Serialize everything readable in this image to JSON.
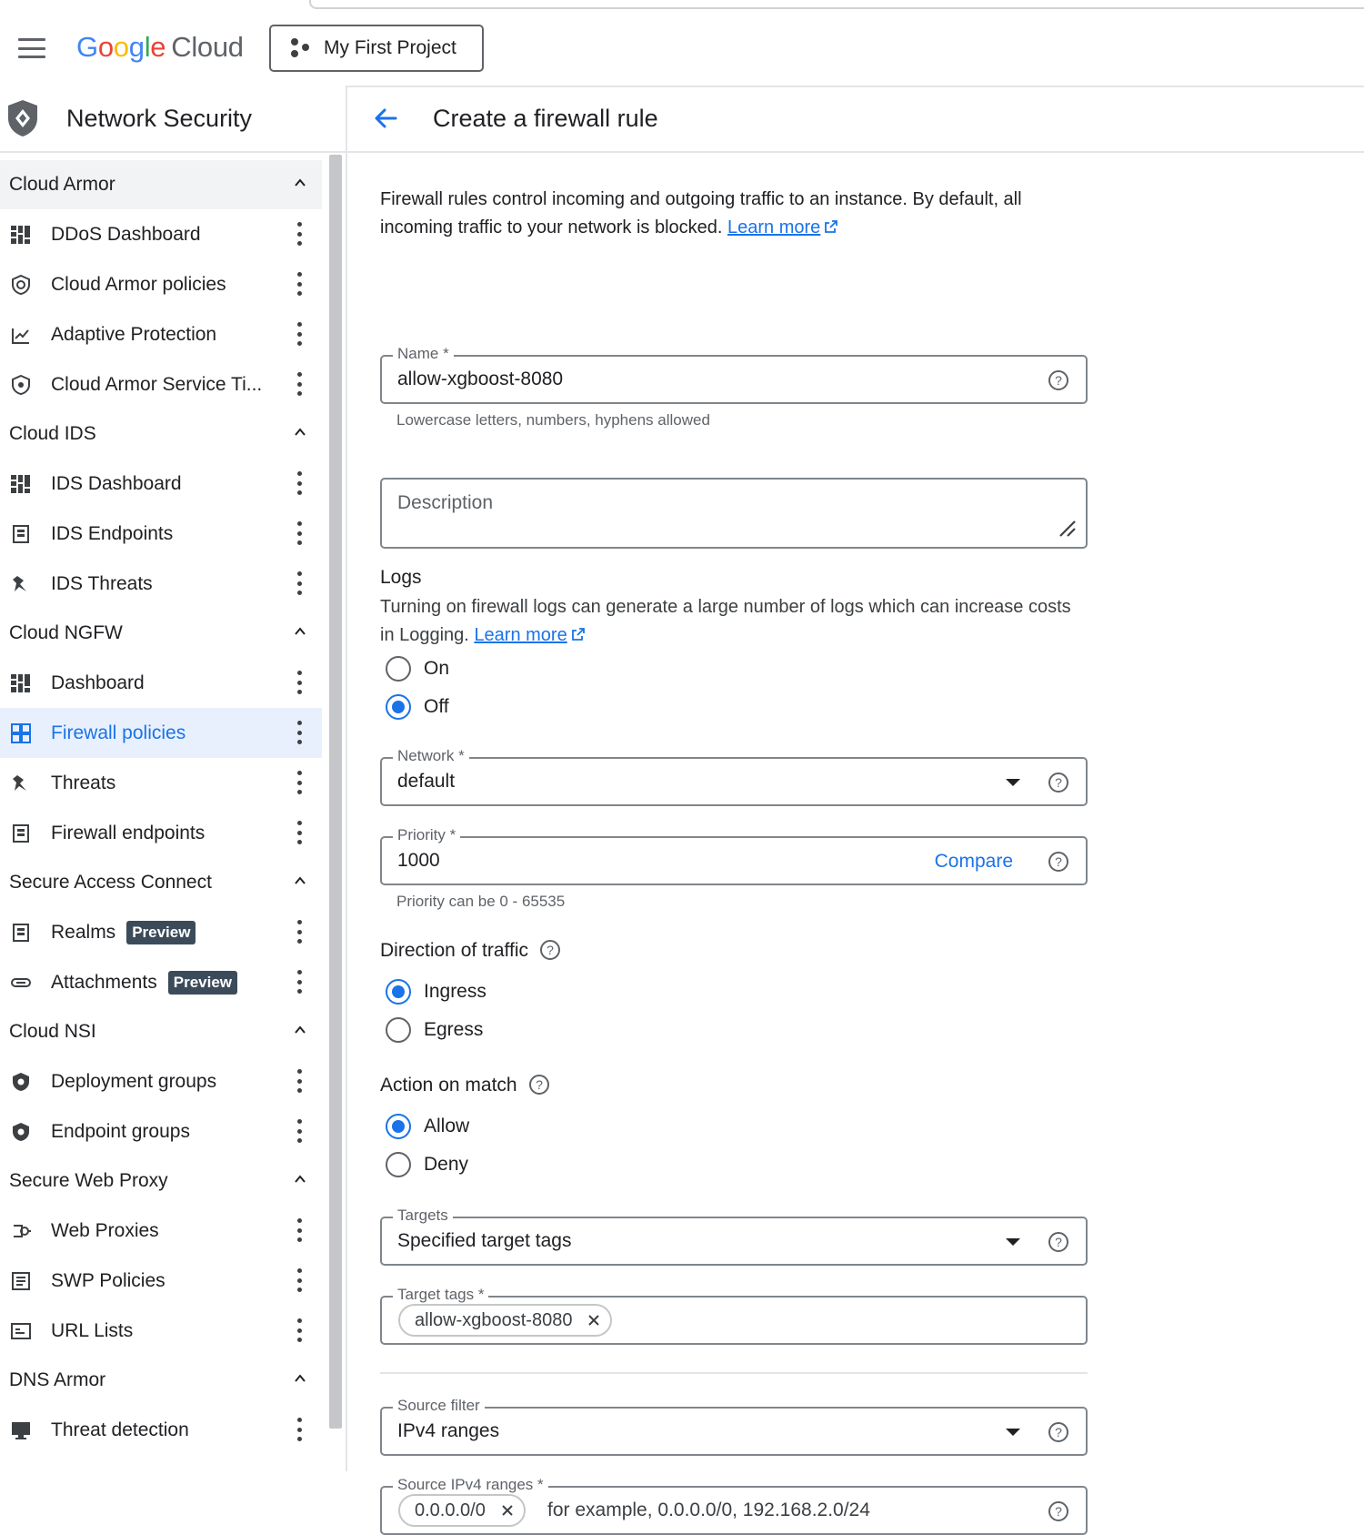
{
  "header": {
    "logo_google": [
      "G",
      "o",
      "o",
      "g",
      "l",
      "e"
    ],
    "logo_cloud": "Cloud",
    "project": "My First Project"
  },
  "sidebar": {
    "title": "Network Security",
    "sections": [
      {
        "title": "Cloud Armor",
        "items": [
          {
            "label": "DDoS Dashboard",
            "icon": "dashboard-icon"
          },
          {
            "label": "Cloud Armor policies",
            "icon": "shield-policy-icon"
          },
          {
            "label": "Adaptive Protection",
            "icon": "adaptive-chart-icon"
          },
          {
            "label": "Cloud Armor Service Ti...",
            "icon": "shield-icon"
          }
        ]
      },
      {
        "title": "Cloud IDS",
        "items": [
          {
            "label": "IDS Dashboard",
            "icon": "dashboard-icon"
          },
          {
            "label": "IDS Endpoints",
            "icon": "endpoint-icon"
          },
          {
            "label": "IDS Threats",
            "icon": "threat-icon"
          }
        ]
      },
      {
        "title": "Cloud NGFW",
        "items": [
          {
            "label": "Dashboard",
            "icon": "dashboard-icon"
          },
          {
            "label": "Firewall policies",
            "icon": "firewall-grid-icon",
            "active": true
          },
          {
            "label": "Threats",
            "icon": "threat-icon"
          },
          {
            "label": "Firewall endpoints",
            "icon": "endpoint-icon"
          }
        ]
      },
      {
        "title": "Secure Access Connect",
        "items": [
          {
            "label": "Realms",
            "icon": "endpoint-icon",
            "badge": "Preview"
          },
          {
            "label": "Attachments",
            "icon": "link-icon",
            "badge": "Preview"
          }
        ]
      },
      {
        "title": "Cloud NSI",
        "items": [
          {
            "label": "Deployment groups",
            "icon": "shield-gear-icon"
          },
          {
            "label": "Endpoint groups",
            "icon": "shield-gear-icon"
          }
        ]
      },
      {
        "title": "Secure Web Proxy",
        "items": [
          {
            "label": "Web Proxies",
            "icon": "proxy-icon"
          },
          {
            "label": "SWP Policies",
            "icon": "list-icon"
          },
          {
            "label": "URL Lists",
            "icon": "url-list-icon"
          }
        ]
      },
      {
        "title": "DNS Armor",
        "items": [
          {
            "label": "Threat detection",
            "icon": "monitor-icon"
          }
        ]
      }
    ]
  },
  "main": {
    "title": "Create a firewall rule",
    "intro": "Firewall rules control incoming and outgoing traffic to an instance. By default, all incoming traffic to your network is blocked.",
    "learn_more": "Learn more",
    "name_label": "Name *",
    "name_value": "allow-xgboost-8080",
    "name_hint": "Lowercase letters, numbers, hyphens allowed",
    "description_placeholder": "Description",
    "logs_title": "Logs",
    "logs_text": "Turning on firewall logs can generate a large number of logs which can increase costs in Logging.",
    "logs_on": "On",
    "logs_off": "Off",
    "network_label": "Network *",
    "network_value": "default",
    "priority_label": "Priority *",
    "priority_value": "1000",
    "compare": "Compare",
    "priority_hint": "Priority can be 0 - 65535",
    "direction_title": "Direction of traffic",
    "ingress": "Ingress",
    "egress": "Egress",
    "action_title": "Action on match",
    "allow": "Allow",
    "deny": "Deny",
    "targets_label": "Targets",
    "targets_value": "Specified target tags",
    "target_tags_label": "Target tags *",
    "target_tag_chip": "allow-xgboost-8080",
    "source_filter_label": "Source filter",
    "source_filter_value": "IPv4 ranges",
    "source_ranges_label": "Source IPv4 ranges *",
    "source_range_chip": "0.0.0.0/0",
    "source_ranges_placeholder": "for example, 0.0.0.0/0, 192.168.2.0/24"
  },
  "colors": {
    "accent": "#1a73e8",
    "badge": "#3c4b5a",
    "active_bg": "#e8f0fe"
  }
}
